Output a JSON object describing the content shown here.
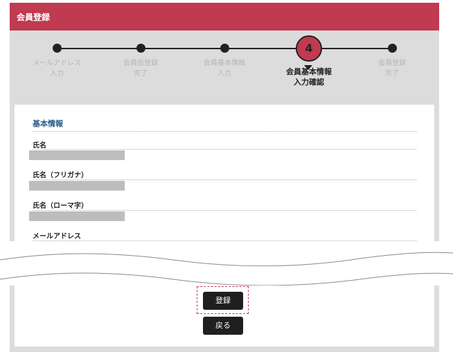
{
  "header": {
    "title": "会員登録"
  },
  "steps": [
    {
      "label_line1": "メールアドレス",
      "label_line2": "入力"
    },
    {
      "label_line1": "会員仮登録",
      "label_line2": "完了"
    },
    {
      "label_line1": "会員基本情報",
      "label_line2": "入力"
    },
    {
      "number": "4",
      "label_line1": "会員基本情報",
      "label_line2": "入力確認"
    },
    {
      "label_line1": "会員登録",
      "label_line2": "完了"
    }
  ],
  "current_step": 4,
  "section": {
    "title": "基本情報"
  },
  "fields": [
    {
      "label": "氏名"
    },
    {
      "label": "氏名（フリガナ）"
    },
    {
      "label": "氏名（ローマ字）"
    },
    {
      "label": "メールアドレス"
    }
  ],
  "buttons": {
    "register": "登録",
    "back": "戻る"
  },
  "colors": {
    "accent": "#c03a50",
    "section_title": "#2a5a8a",
    "button": "#1f1f1f",
    "frame": "#dcdcdc"
  }
}
